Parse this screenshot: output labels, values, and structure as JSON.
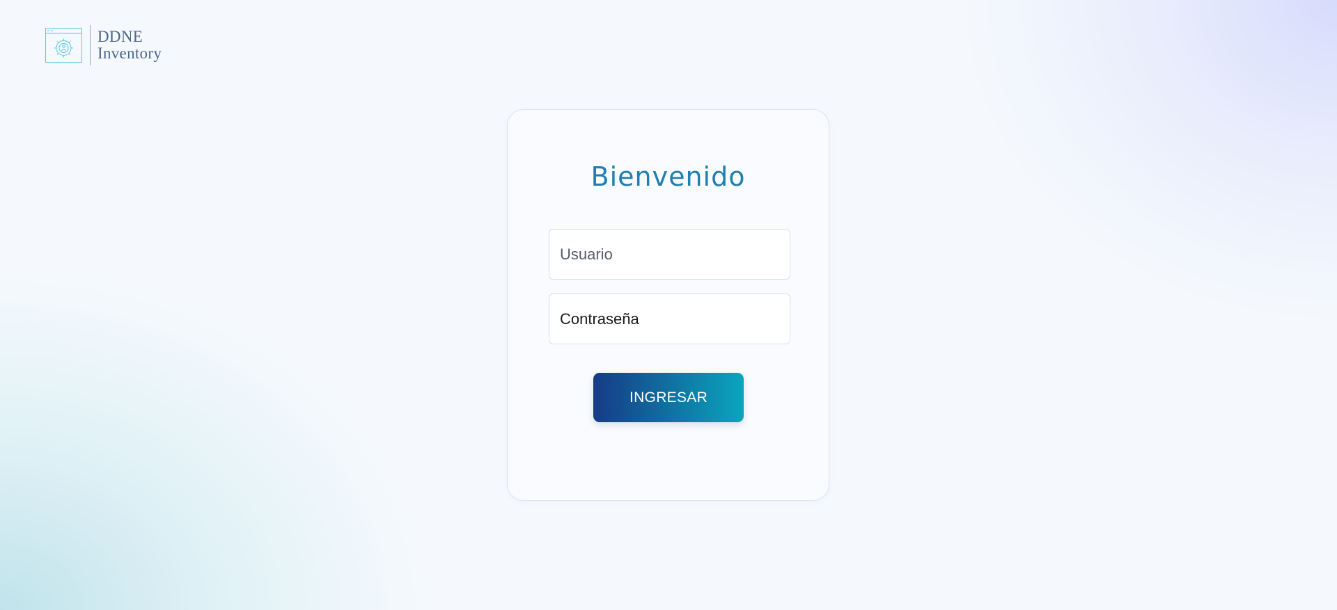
{
  "brand": {
    "line1": "DDNE",
    "line2": "Inventory",
    "icon": "gear-person-window-icon"
  },
  "login": {
    "title": "Bienvenido",
    "username_placeholder": "Usuario",
    "password_placeholder": "Contraseña",
    "submit_label": "INGRESAR"
  },
  "colors": {
    "title": "#1f7fb0",
    "button_gradient_start": "#163b86",
    "button_gradient_end": "#0aa5bd",
    "logo_text": "#4b6688",
    "logo_icon": "#5bc6e4"
  }
}
